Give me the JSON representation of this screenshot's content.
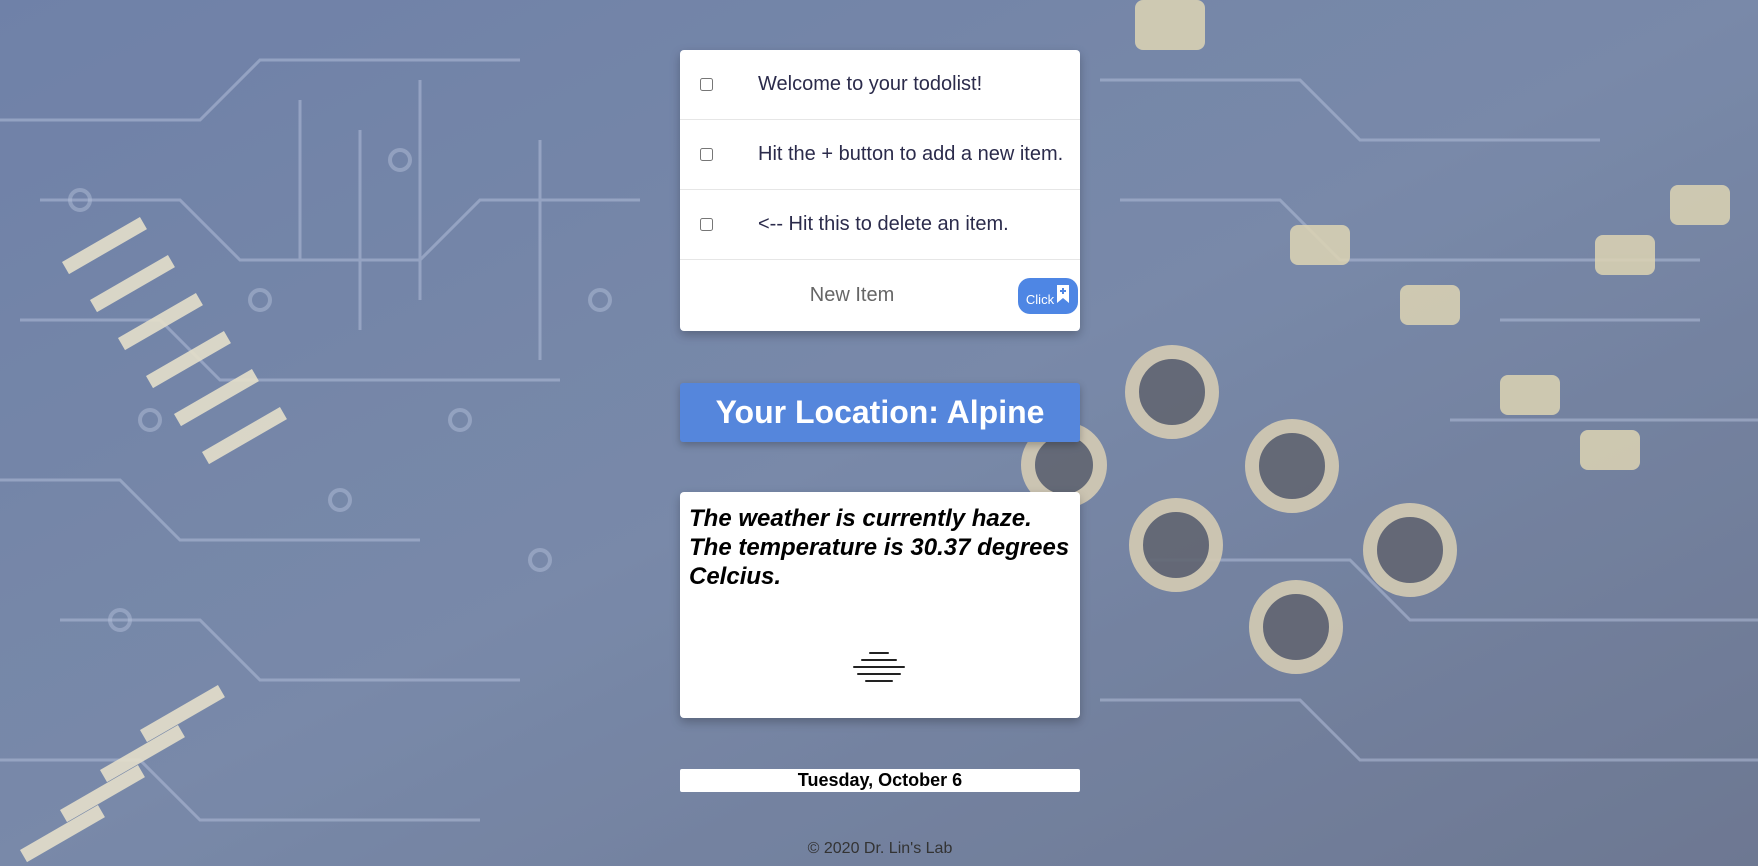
{
  "todo": {
    "items": [
      {
        "label": "Welcome to your todolist!",
        "checked": false
      },
      {
        "label": "Hit the + button to add a new item.",
        "checked": false
      },
      {
        "label": "<-- Hit this to delete an item.",
        "checked": false
      }
    ],
    "new_item_placeholder": "New Item",
    "add_button_label": "Click",
    "add_button_icon": "bookmark-plus-icon",
    "accent_color": "#4e86e4"
  },
  "location": {
    "banner_text": "Your Location: Alpine",
    "banner_color": "#5586dc"
  },
  "weather": {
    "description": "The weather is currently haze. The temperature is 30.37 degrees Celcius.",
    "icon": "haze-icon"
  },
  "date": {
    "text": "Tuesday, October 6"
  },
  "footer": {
    "text": "© 2020 Dr. Lin's Lab"
  }
}
